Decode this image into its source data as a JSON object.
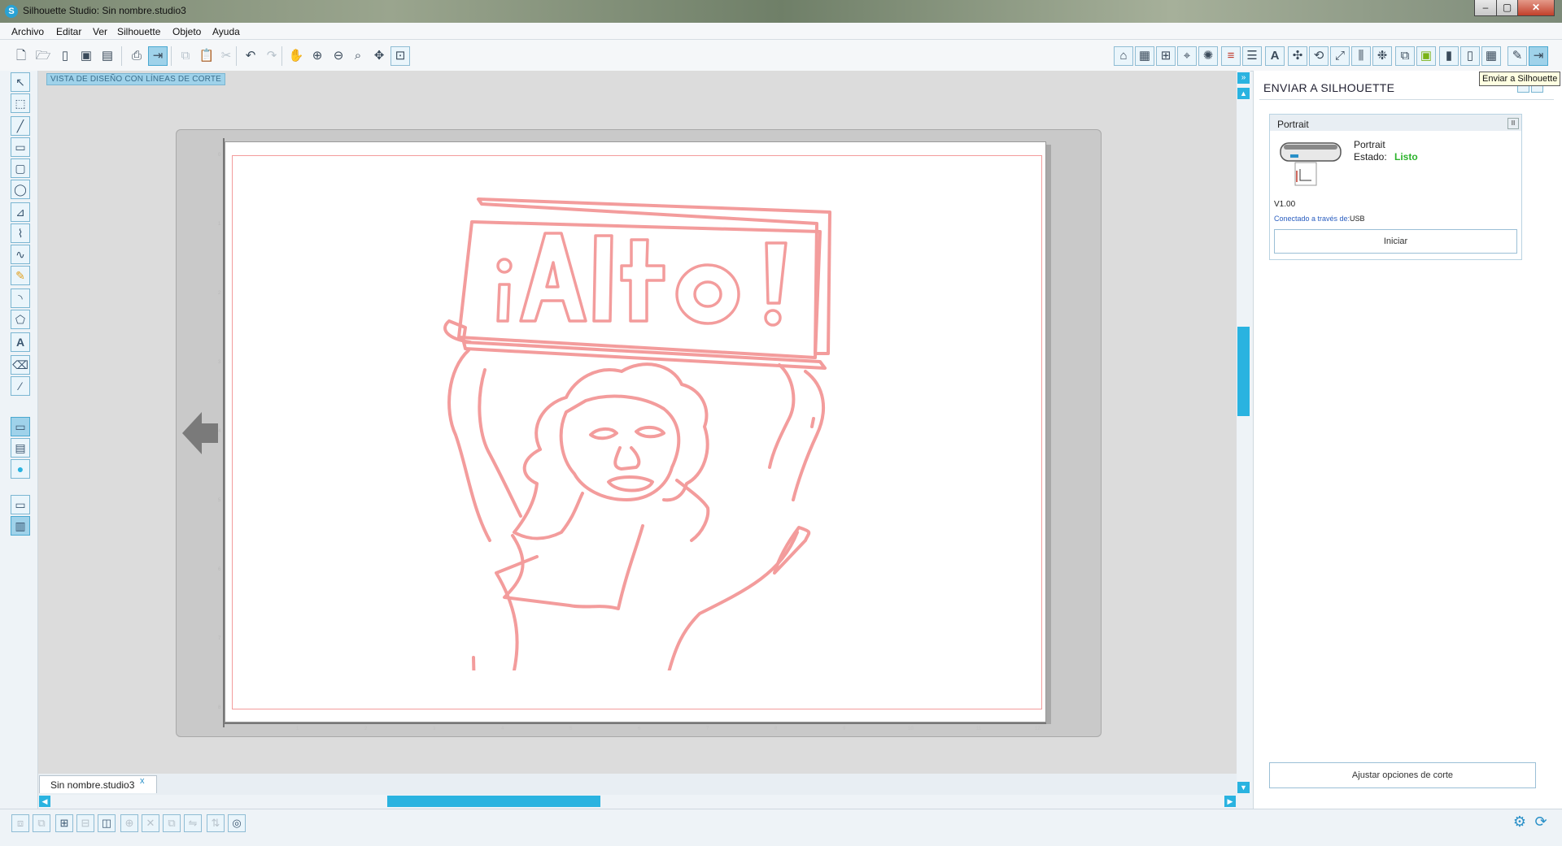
{
  "window": {
    "title": "Silhouette Studio: Sin nombre.studio3",
    "controls": {
      "minimize": "–",
      "maximize": "▢",
      "close": "✕"
    }
  },
  "menu": [
    "Archivo",
    "Editar",
    "Ver",
    "Silhouette",
    "Objeto",
    "Ayuda"
  ],
  "toolbar": {
    "left_icons": [
      "new-icon",
      "open-icon",
      "template-icon",
      "save-icon",
      "save-to-library-icon",
      "print-icon",
      "send-to-silhouette-icon",
      "copy-icon",
      "paste-icon",
      "cut-icon",
      "undo-icon",
      "redo-icon",
      "pan-icon",
      "zoom-in-icon",
      "zoom-out-icon",
      "zoom-selection-icon",
      "drag-zoom-icon",
      "fit-to-page-icon"
    ],
    "right_icons": [
      "page-settings-icon",
      "grid-settings-icon",
      "registration-icon",
      "cut-settings-icon",
      "fill-color-icon",
      "line-color-icon",
      "line-style-icon",
      "text-style-icon",
      "transform-icon",
      "rotate-icon",
      "scale-icon",
      "move-icon",
      "align-icon",
      "replicate-icon",
      "nest-icon",
      "modify-icon",
      "offset-icon",
      "trace-icon",
      "library-icon",
      "store-icon",
      "send-icon"
    ]
  },
  "tooltip": "Enviar a Silhouette",
  "canvas": {
    "view_label": "VISTA DE DISEÑO CON LÍNEAS DE CORTE",
    "artwork_text": "¡Alto!"
  },
  "tabs": [
    {
      "label": "Sin nombre.studio3",
      "close": "x"
    }
  ],
  "panel": {
    "title": "ENVIAR A SILHOUETTE",
    "device": {
      "header": "Portrait",
      "pause": "II",
      "model": "Portrait",
      "status_label": "Estado:",
      "status_value": "Listo",
      "version": "V1.00",
      "connection_label": "Conectado a través de:",
      "connection_value": "USB",
      "start_button": "Iniciar"
    },
    "adjust_button": "Ajustar opciones de corte"
  },
  "colors": {
    "accent": "#2ab3e0",
    "cut_line": "#f39c9c",
    "status_ready": "#2cb32c"
  }
}
